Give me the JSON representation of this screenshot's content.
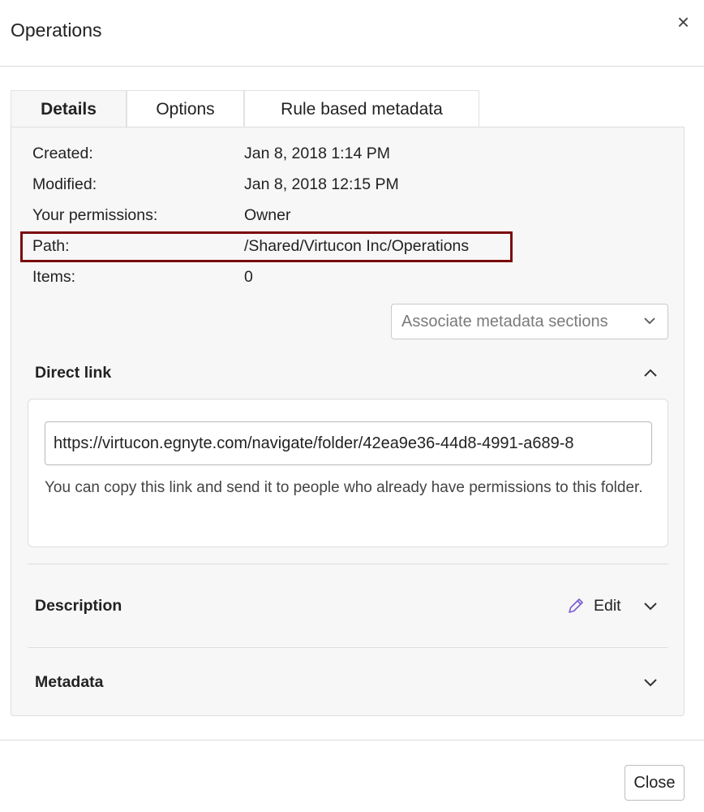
{
  "dialog": {
    "title": "Operations",
    "close_icon": "×"
  },
  "tabs": [
    {
      "label": "Details",
      "active": true
    },
    {
      "label": "Options",
      "active": false
    },
    {
      "label": "Rule based metadata",
      "active": false
    }
  ],
  "details": {
    "created_label": "Created:",
    "created_value": "Jan 8, 2018 1:14 PM",
    "modified_label": "Modified:",
    "modified_value": "Jan 8, 2018 12:15 PM",
    "permissions_label": "Your permissions:",
    "permissions_value": "Owner",
    "path_label": "Path:",
    "path_value": "/Shared/Virtucon Inc/Operations",
    "items_label": "Items:",
    "items_value": "0"
  },
  "associate_dropdown": {
    "label": "Associate metadata sections"
  },
  "direct_link": {
    "title": "Direct link",
    "url": "https://virtucon.egnyte.com/navigate/folder/42ea9e36-44d8-4991-a689-8",
    "hint": "You can copy this link and send it to people who already have permissions to this folder."
  },
  "description": {
    "title": "Description",
    "edit_label": "Edit"
  },
  "metadata": {
    "title": "Metadata"
  },
  "footer": {
    "close_label": "Close"
  },
  "colors": {
    "highlight_border": "#7a0a0a",
    "edit_icon": "#7b5bd6"
  }
}
